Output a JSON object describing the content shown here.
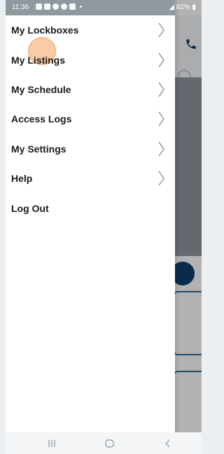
{
  "status_bar": {
    "time": "11:36",
    "battery": "82%"
  },
  "menu": {
    "items": [
      {
        "label": "My Lockboxes",
        "chevron": true
      },
      {
        "label": "My Listings",
        "chevron": true
      },
      {
        "label": "My Schedule",
        "chevron": true
      },
      {
        "label": "Access Logs",
        "chevron": true
      },
      {
        "label": "My Settings",
        "chevron": true
      },
      {
        "label": "Help",
        "chevron": true
      },
      {
        "label": "Log Out",
        "chevron": false
      }
    ]
  },
  "icons": {
    "chevron": "chevron-right-icon",
    "background_phone": "phone-icon",
    "background_profile": "person-icon",
    "nav_recent": "recent-apps-icon",
    "nav_home": "home-icon",
    "nav_back": "back-icon"
  },
  "colors": {
    "menu_text": "#1a1a1a",
    "chevron": "#9aa3a8",
    "tap_indicator": "#f6ba8c",
    "accent_dark_blue": "#0f3f6e",
    "card_border": "#2c6a98",
    "scrim_content": "#8e979e"
  }
}
